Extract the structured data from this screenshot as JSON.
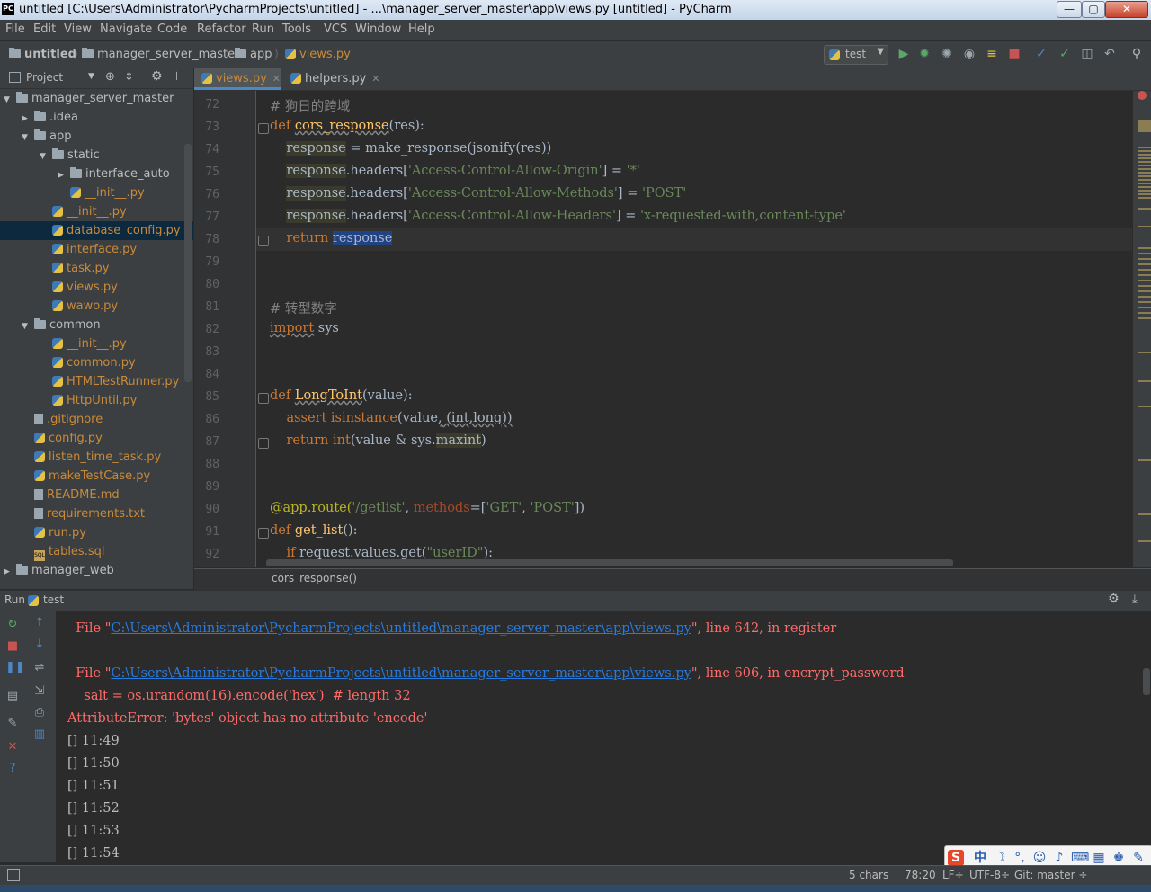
{
  "window": {
    "logo": "PC",
    "title": "untitled [C:\\Users\\Administrator\\PycharmProjects\\untitled] - ...\\manager_server_master\\app\\views.py [untitled] - PyCharm",
    "min": "—",
    "max": "▢",
    "close": "✕"
  },
  "menu": [
    "File",
    "Edit",
    "View",
    "Navigate",
    "Code",
    "Refactor",
    "Run",
    "Tools",
    "VCS",
    "Window",
    "Help"
  ],
  "nav": {
    "crumbs": [
      "untitled",
      "manager_server_master",
      "app",
      "views.py"
    ],
    "run_config": "test"
  },
  "project": {
    "header": "Project",
    "tree": [
      {
        "label": "manager_server_master",
        "type": "folder",
        "open": true
      },
      {
        "label": ".idea",
        "type": "folder",
        "open": false
      },
      {
        "label": "app",
        "type": "folder",
        "open": true
      },
      {
        "label": "static",
        "type": "folder",
        "open": true
      },
      {
        "label": "interface_auto",
        "type": "folder",
        "open": false
      },
      {
        "label": "__init__.py",
        "type": "py"
      },
      {
        "label": "__init__.py",
        "type": "py"
      },
      {
        "label": "database_config.py",
        "type": "py",
        "selected": true
      },
      {
        "label": "interface.py",
        "type": "py"
      },
      {
        "label": "task.py",
        "type": "py"
      },
      {
        "label": "views.py",
        "type": "py"
      },
      {
        "label": "wawo.py",
        "type": "py"
      },
      {
        "label": "common",
        "type": "folder",
        "open": true
      },
      {
        "label": "__init__.py",
        "type": "py"
      },
      {
        "label": "common.py",
        "type": "py"
      },
      {
        "label": "HTMLTestRunner.py",
        "type": "py"
      },
      {
        "label": "HttpUntil.py",
        "type": "py"
      },
      {
        "label": ".gitignore",
        "type": "file"
      },
      {
        "label": "config.py",
        "type": "py"
      },
      {
        "label": "listen_time_task.py",
        "type": "py"
      },
      {
        "label": "makeTestCase.py",
        "type": "py"
      },
      {
        "label": "README.md",
        "type": "file"
      },
      {
        "label": "requirements.txt",
        "type": "file"
      },
      {
        "label": "run.py",
        "type": "py"
      },
      {
        "label": "tables.sql",
        "type": "sql"
      },
      {
        "label": "manager_web",
        "type": "folder",
        "open": false
      }
    ]
  },
  "tabs": [
    {
      "label": "views.py",
      "active": true
    },
    {
      "label": "helpers.py",
      "active": false
    }
  ],
  "editor": {
    "line_numbers": [
      "72",
      "73",
      "74",
      "75",
      "76",
      "77",
      "78",
      "79",
      "80",
      "81",
      "82",
      "83",
      "84",
      "85",
      "86",
      "87",
      "88",
      "89",
      "90",
      "91",
      "92"
    ],
    "comment_1": "# 狗日的跨域",
    "def_kw": "def",
    "fn_cors": "cors_response",
    "res_sig": "(res):",
    "response": "response",
    "l74_rest": " = make_response(jsonify(res))",
    "headers": ".headers[",
    "h1": "'Access-Control-Allow-Origin'",
    "v1": "'*'",
    "h2": "'Access-Control-Allow-Methods'",
    "v2": "'POST'",
    "h3": "'Access-Control-Allow-Headers'",
    "v3": "'x-requested-with,content-type'",
    "assign_close": "] = ",
    "return_kw": "return",
    "comment_2": "# 转型数字",
    "import_kw": "import",
    "sys": " sys",
    "fn_long": "LongToInt",
    "value_sig": "(value):",
    "assert_kw": "assert",
    "isinstance": "isinstance",
    "l86_args": "(value",
    "l86_comma": ",",
    "l86_tail": " (int,long))",
    "int_fn": "int",
    "l87_mid": "(value & sys.",
    "maxint": "maxint",
    "l87_end": ")",
    "decorator": "@app.route(",
    "route": "'/getlist'",
    "methods": "methods",
    "methods_eq": "=[",
    "get": "'GET'",
    "post": "'POST'",
    "methods_end": "])",
    "comma_sp": ", ",
    "fn_get_list": "get_list",
    "empty_sig": "():",
    "if_kw": "if",
    "l92_mid": " request.values.get(",
    "userid": "\"userID\"",
    "l92_end": "):",
    "bottom_crumb": "cors_response()"
  },
  "run": {
    "label": "Run",
    "config": "test",
    "file1_pre": "  File \"",
    "file_link": "C:\\Users\\Administrator\\PycharmProjects\\untitled\\manager_server_master\\app\\views.py",
    "file1_post": "\", line 642, in register",
    "file2_pre": "  File \"",
    "file2_post": "\", line 606, in encrypt_password",
    "salt_line": "    salt = os.urandom(16).encode('hex')  # length 32",
    "error": "AttributeError: 'bytes' object has no attribute 'encode'",
    "log": [
      "[] 11:49",
      "[] 11:50",
      "[] 11:51",
      "[] 11:52",
      "[] 11:53",
      "[] 11:54"
    ]
  },
  "status": {
    "chars": "5 chars",
    "pos": "78:20",
    "lf": "LF÷",
    "enc": "UTF-8÷",
    "git": "Git: master ÷"
  },
  "ime": {
    "logo": "S",
    "mode": "中"
  },
  "colors": {
    "accent": "#4a88c7",
    "error": "#ff6b68",
    "link": "#287bde",
    "bg": "#2b2b2b"
  }
}
